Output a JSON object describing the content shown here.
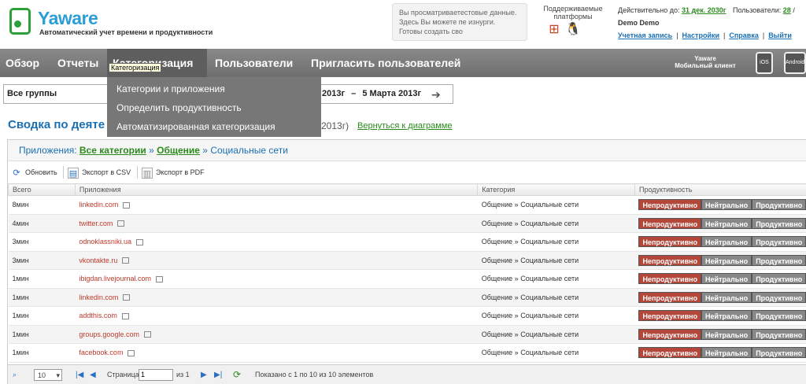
{
  "header": {
    "logo_title": "Yaware",
    "logo_subtitle": "Автоматический учет времени и продуктивности",
    "demo_note": [
      "Вы просматриваетестовые данные.",
      "Здесь Вы можете пе изнурги.",
      "Готовы создать сво"
    ],
    "platforms_label": [
      "Поддерживаемые",
      "платформы"
    ],
    "valid_until_label": "Действительно до:",
    "valid_until_value": "31 дек. 2030г",
    "users_label": "Пользователи:",
    "users_value": "28",
    "users_sep": "/",
    "username": "Demo Demo",
    "account_links": [
      "Учетная запись",
      "Настройки",
      "Справка",
      "Выйти"
    ]
  },
  "nav": {
    "items": [
      "Обзор",
      "Отчеты",
      "Категоризация",
      "Пользователи",
      "Пригласить пользователей"
    ],
    "tooltip": "Категоризация",
    "mobile_client": [
      "Yaware",
      "Мобильный клиент"
    ],
    "ios_label": "iOS",
    "android_label": "Android"
  },
  "dropdown": [
    "Категории и приложения",
    "Определить продуктивность",
    "Автоматизированная категоризация"
  ],
  "filter": {
    "group": "Все группы",
    "date_from": "2013г",
    "date_dash": "–",
    "date_to": "5 Марта 2013г"
  },
  "summary": {
    "title": "Сводка по деяте",
    "suffix": "2013г)",
    "back_link": "Вернуться к диаграмме"
  },
  "breadcrumbs": {
    "prefix": "Приложения:",
    "all": "Все категории",
    "sep": "»",
    "mid": "Общение",
    "current": "Социальные сети"
  },
  "toolbar": {
    "refresh": "Обновить",
    "csv": "Экспорт в CSV",
    "pdf": "Экспорт в PDF"
  },
  "table": {
    "headers": [
      "Всего",
      "Приложения",
      "Категория",
      "Продуктивность"
    ],
    "rows": [
      {
        "total": "8мин",
        "app": "linkedin.com",
        "category": "Общение » Социальные сети"
      },
      {
        "total": "4мин",
        "app": "twitter.com",
        "category": "Общение » Социальные сети"
      },
      {
        "total": "3мин",
        "app": "odnoklassniki.ua",
        "category": "Общение » Социальные сети"
      },
      {
        "total": "3мин",
        "app": "vkontakte.ru",
        "category": "Общение » Социальные сети"
      },
      {
        "total": "1мин",
        "app": "ibigdan.livejournal.com",
        "category": "Общение » Социальные сети"
      },
      {
        "total": "1мин",
        "app": "linkedin.com",
        "category": "Общение » Социальные сети"
      },
      {
        "total": "1мин",
        "app": "addthis.com",
        "category": "Общение » Социальные сети"
      },
      {
        "total": "1мин",
        "app": "groups.google.com",
        "category": "Общение » Социальные сети"
      },
      {
        "total": "1мин",
        "app": "facebook.com",
        "category": "Общение » Социальные сети"
      }
    ],
    "prod_buttons": [
      "Непродуктивно",
      "Нейтрально",
      "Продуктивно"
    ]
  },
  "pager": {
    "page_size": "10",
    "page_label": "Страница",
    "page_value": "1",
    "of_label": "из 1",
    "shown": "Показано с 1 по 10 из 10 элементов"
  },
  "colors": {
    "brand_blue": "#2c9ed6",
    "brand_green": "#2ea03a",
    "nav_bg": "#7a7a7a",
    "unproductive": "#b5463a"
  },
  "icons": {
    "windows": "windows-icon",
    "linux": "linux-icon",
    "apple": "apple-icon",
    "refresh": "refresh-icon",
    "csv": "csv-export-icon",
    "pdf": "pdf-export-icon"
  }
}
